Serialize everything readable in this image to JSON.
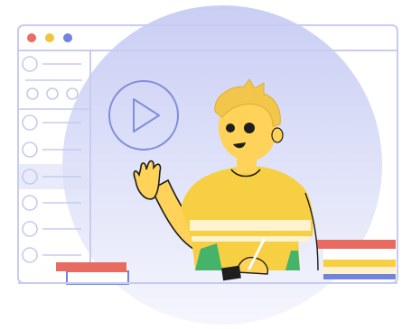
{
  "colors": {
    "window_border": "#c7ccf0",
    "sidebar_line": "#c5cbee",
    "bg_circle_top": "#c9cef4",
    "bg_circle_bottom": "#f3f4fd",
    "dot_red": "#ee6b62",
    "dot_yellow": "#f5c33b",
    "dot_blue": "#6f84df",
    "hair": "#f2c54b",
    "skin": "#ffd25a",
    "shirt": "#f7cf43",
    "shirt_stripe": "#fff3cf",
    "book_red": "#e76b61",
    "book_yellow": "#f7cf43",
    "book_blue": "#6f84df",
    "pants_green": "#46b36a",
    "ink": "#1e1e1e"
  },
  "icons": {
    "play": "play-icon",
    "window_controls": "window-controls-icon",
    "avatar": "person-illustration"
  }
}
